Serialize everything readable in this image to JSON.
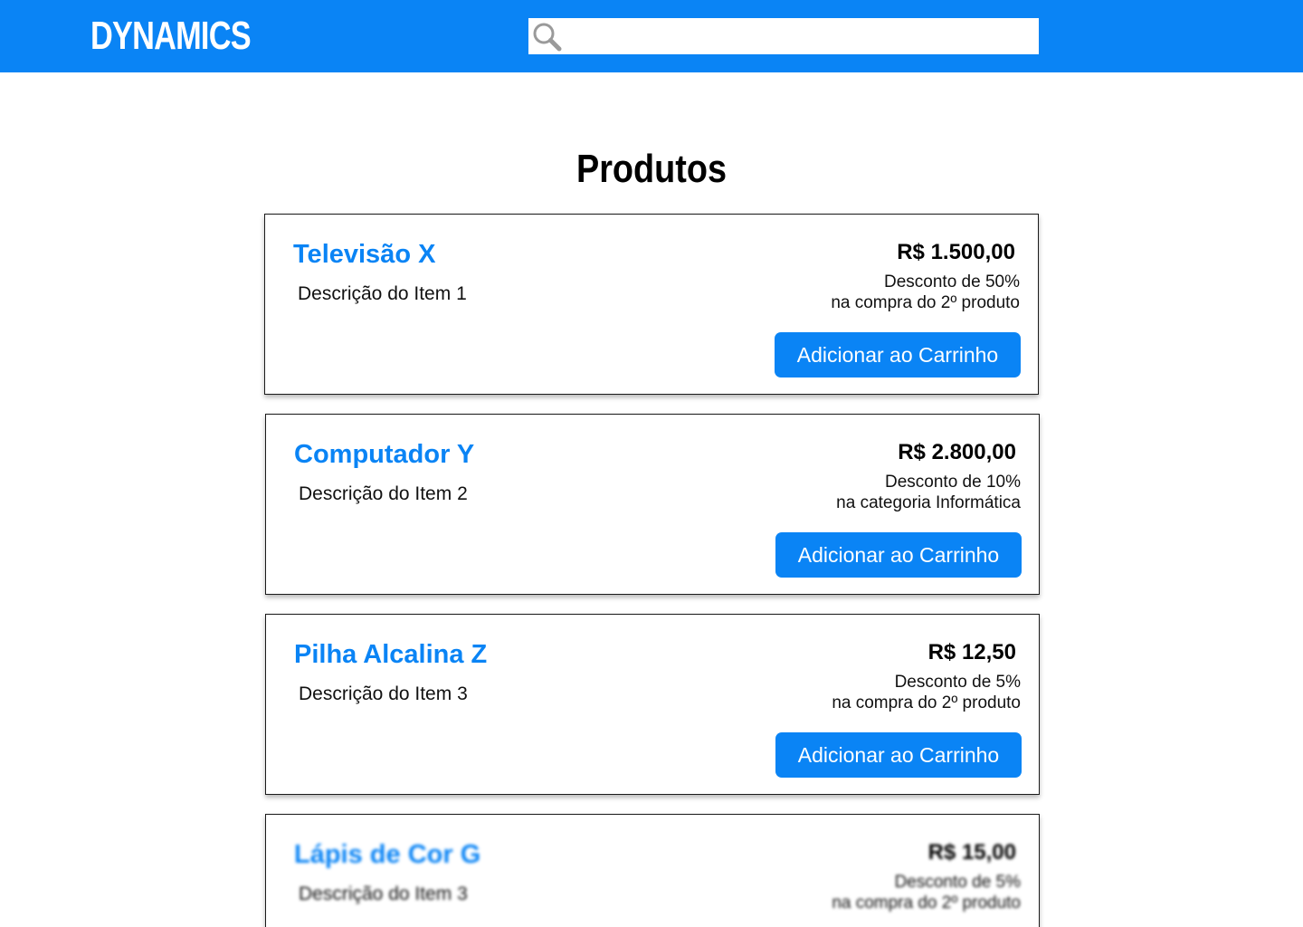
{
  "header": {
    "logo": "DYNAMICS",
    "search": {
      "placeholder": "",
      "value": ""
    },
    "background_color": "#0a84f5"
  },
  "main": {
    "title": "Produtos",
    "products": [
      {
        "name": "Televisão X",
        "description": "Descrição do Item 1",
        "price": "R$ 1.500,00",
        "discount_line1": "Desconto de 50%",
        "discount_line2": "na compra do 2º produto",
        "button_label": "Adicionar ao Carrinho"
      },
      {
        "name": "Computador Y",
        "description": "Descrição do Item 2",
        "price": "R$ 2.800,00",
        "discount_line1": "Desconto de 10%",
        "discount_line2": "na categoria Informática",
        "button_label": "Adicionar ao Carrinho"
      },
      {
        "name": "Pilha Alcalina Z",
        "description": "Descrição do Item 3",
        "price": "R$ 12,50",
        "discount_line1": "Desconto de 5%",
        "discount_line2": "na compra do 2º produto",
        "button_label": "Adicionar ao Carrinho"
      },
      {
        "name": "Lápis de Cor G",
        "description": "Descrição do Item 3",
        "price": "R$ 15,00",
        "discount_line1": "Desconto de 5%",
        "discount_line2": "na compra do 2º produto"
      }
    ]
  },
  "colors": {
    "accent": "#0a84f5",
    "text": "#000000",
    "background": "#ffffff"
  }
}
